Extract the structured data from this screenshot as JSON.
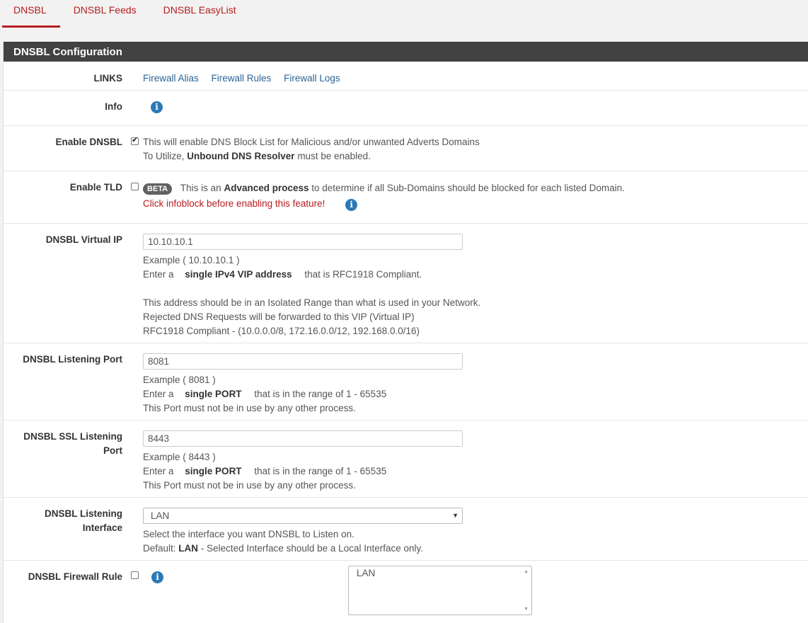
{
  "tabs": [
    {
      "label": "DNSBL",
      "active": true
    },
    {
      "label": "DNSBL Feeds",
      "active": false
    },
    {
      "label": "DNSBL EasyList",
      "active": false
    }
  ],
  "panel": {
    "title": "DNSBL Configuration"
  },
  "links": {
    "label": "LINKS",
    "items": [
      "Firewall Alias",
      "Firewall Rules",
      "Firewall Logs"
    ]
  },
  "info": {
    "label": "Info"
  },
  "enable_dnsbl": {
    "label": "Enable DNSBL",
    "checked": true,
    "line1": "This will enable DNS Block List for Malicious and/or unwanted Adverts Domains",
    "line2_pre": "To Utilize,",
    "line2_bold": "Unbound DNS Resolver",
    "line2_post": "must be enabled."
  },
  "enable_tld": {
    "label": "Enable TLD",
    "checked": false,
    "badge": "BETA",
    "text_pre": "This is an",
    "text_bold": "Advanced process",
    "text_post": "to determine if all Sub-Domains should be blocked for each listed Domain.",
    "warning": "Click infoblock before enabling this feature!"
  },
  "virtual_ip": {
    "label": "DNSBL Virtual IP",
    "value": "10.10.10.1",
    "example": "Example ( 10.10.10.1 )",
    "line2_pre": "Enter a",
    "line2_bold": "single IPv4 VIP address",
    "line2_post": "that is RFC1918 Compliant.",
    "line3": "This address should be in an Isolated Range than what is used in your Network.",
    "line4": "Rejected DNS Requests will be forwarded to this VIP (Virtual IP)",
    "line5": "RFC1918 Compliant - (10.0.0.0/8, 172.16.0.0/12, 192.168.0.0/16)"
  },
  "listening_port": {
    "label": "DNSBL Listening Port",
    "value": "8081",
    "example": "Example ( 8081 )",
    "line2_pre": "Enter a",
    "line2_bold": "single PORT",
    "line2_post": "that is in the range of 1 - 65535",
    "line3": "This Port must not be in use by any other process."
  },
  "ssl_port": {
    "label_line1": "DNSBL SSL Listening",
    "label_line2": "Port",
    "value": "8443",
    "example": "Example ( 8443 )",
    "line2_pre": "Enter a",
    "line2_bold": "single PORT",
    "line2_post": "that is in the range of 1 - 65535",
    "line3": "This Port must not be in use by any other process."
  },
  "listening_interface": {
    "label_line1": "DNSBL Listening",
    "label_line2": "Interface",
    "selected": "LAN",
    "line1": "Select the interface you want DNSBL to Listen on.",
    "line2_pre": "Default:",
    "line2_bold": "LAN",
    "line2_post": "- Selected Interface should be a Local Interface only."
  },
  "firewall_rule": {
    "label": "DNSBL Firewall Rule",
    "checked": false,
    "options": [
      "LAN"
    ]
  }
}
